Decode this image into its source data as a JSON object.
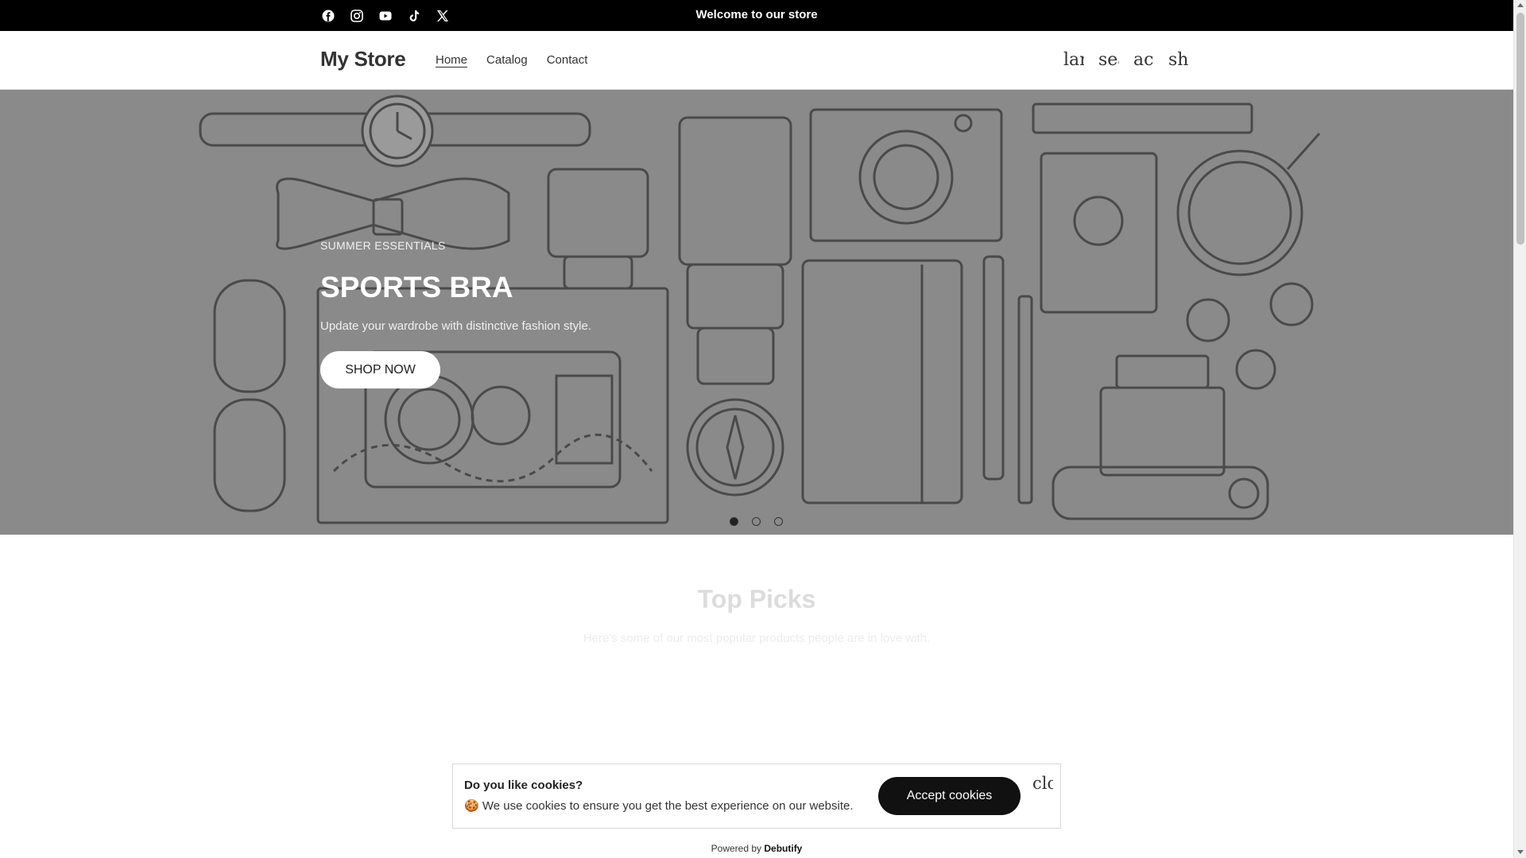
{
  "announcement": {
    "text": "Welcome to our store"
  },
  "socials": [
    {
      "icon": "facebook-icon"
    },
    {
      "icon": "instagram-icon"
    },
    {
      "icon": "youtube-icon"
    },
    {
      "icon": "tiktok-icon"
    },
    {
      "icon": "x-twitter-icon"
    }
  ],
  "header": {
    "logo": "My Store",
    "nav": [
      {
        "label": "Home",
        "active": true
      },
      {
        "label": "Catalog"
      },
      {
        "label": "Contact"
      }
    ],
    "icons": [
      {
        "name": "language-icon",
        "text": "lar"
      },
      {
        "name": "search-icon",
        "text": "sea"
      },
      {
        "name": "account-icon",
        "text": "acc"
      },
      {
        "name": "shopping-bag-icon",
        "text": "sho"
      }
    ]
  },
  "hero": {
    "eyebrow": "SUMMER ESSENTIALS",
    "title": "SPORTS BRA",
    "text": "Update your wardrobe with distinctive fashion style.",
    "button": "SHOP NOW",
    "slides": 3,
    "active_slide": 1
  },
  "top_picks": {
    "title": "Top Picks",
    "subtitle": "Here's some of our most popular products people are in love with."
  },
  "cookie": {
    "heading": "Do you like cookies?",
    "text": "🍪 We use cookies to ensure you get the best experience on our website.",
    "accept": "Accept cookies",
    "close_text": "clo"
  },
  "footer": {
    "powered_prefix": "Powered by",
    "powered_brand": "Debutify"
  },
  "colors": {
    "topbar": "#000000",
    "hero_bg": "#8a8a8a",
    "button_dark": "#111111"
  }
}
